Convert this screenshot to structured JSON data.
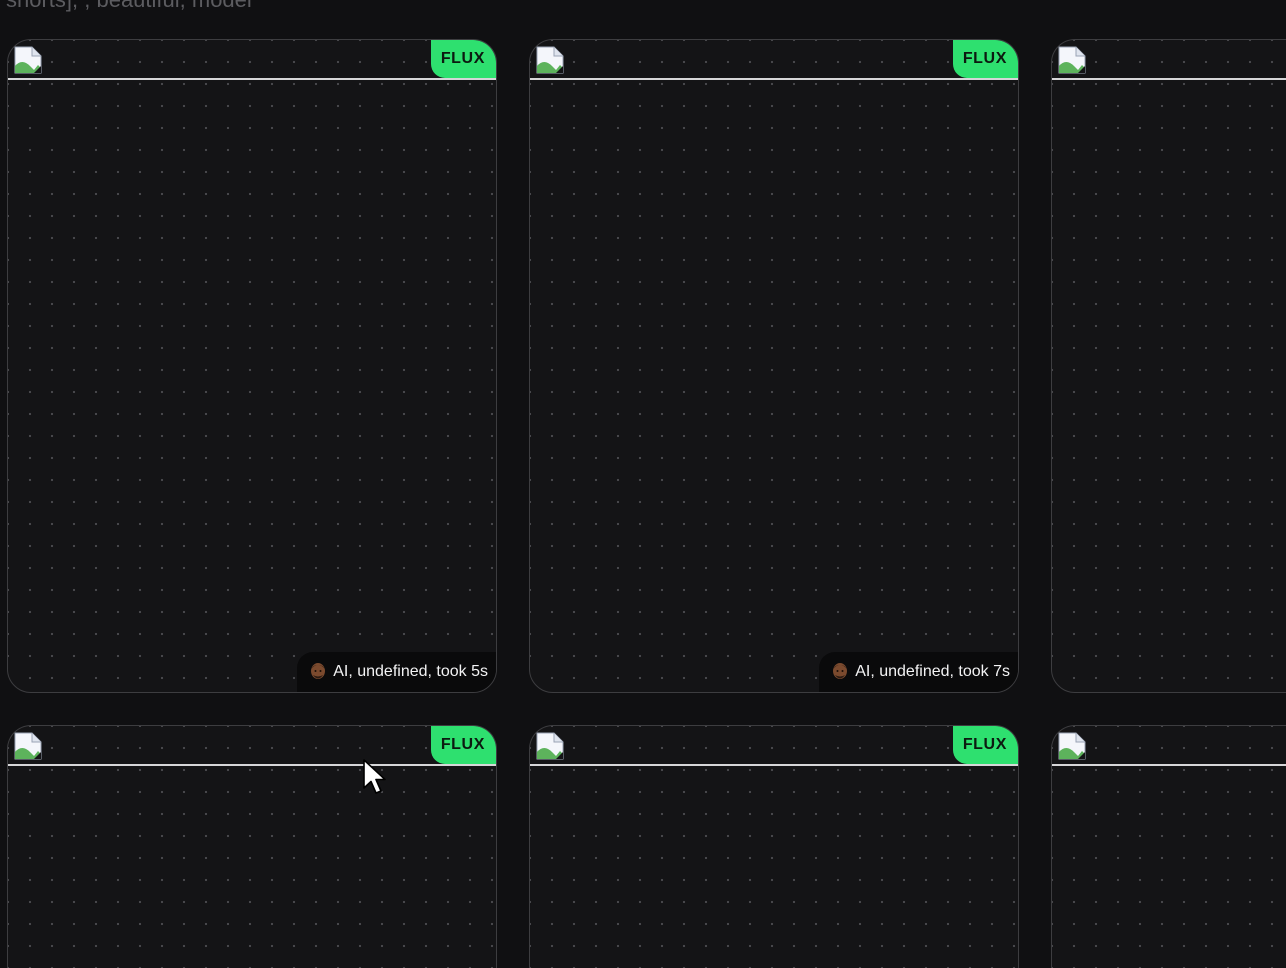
{
  "prompt": {
    "text": "shorts], , beautiful, model"
  },
  "colors": {
    "background": "#101012",
    "card_border": "#3d3d40",
    "badge_green": "#2ee06f",
    "footer_bg": "#0a0a0b"
  },
  "cards": [
    {
      "badge": "FLUX",
      "footer": "AI, undefined, took 5s",
      "icon": "broken-image-icon",
      "avatar": "person-emoji-icon"
    },
    {
      "badge": "FLUX",
      "footer": "AI, undefined, took 7s",
      "icon": "broken-image-icon",
      "avatar": "person-emoji-icon"
    },
    {
      "icon": "broken-image-icon"
    },
    {
      "badge": "FLUX",
      "icon": "broken-image-icon"
    },
    {
      "badge": "FLUX",
      "icon": "broken-image-icon"
    },
    {
      "icon": "broken-image-icon"
    }
  ]
}
